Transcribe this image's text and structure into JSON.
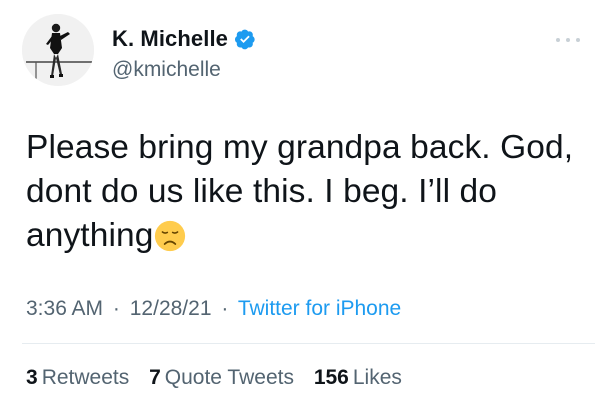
{
  "author": {
    "display_name": "K. Michelle",
    "handle": "@kmichelle",
    "verified": true
  },
  "tweet": {
    "text": "Please bring my grandpa back. God, dont do us like this. I beg. I’ll do anything",
    "emoji": "disappointed-face"
  },
  "meta": {
    "time": "3:36 AM",
    "separator1": "·",
    "date": "12/28/21",
    "separator2": "·",
    "source": "Twitter for iPhone"
  },
  "stats": {
    "retweets": {
      "count": "3",
      "label": "Retweets"
    },
    "quote_tweets": {
      "count": "7",
      "label": "Quote Tweets"
    },
    "likes": {
      "count": "156",
      "label": "Likes"
    }
  },
  "colors": {
    "link": "#1d9bf0",
    "secondary_text": "#536471",
    "primary_text": "#0f1419",
    "verified_badge": "#1d9bf0"
  }
}
